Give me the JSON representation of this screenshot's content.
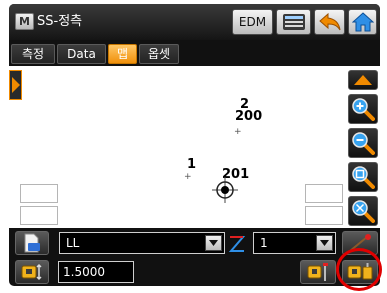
{
  "app": {
    "title": "SS-정측",
    "logo_letter": "M"
  },
  "toolbar": {
    "edm_label": "EDM"
  },
  "tabs": [
    {
      "label": "측정",
      "active": false
    },
    {
      "label": "Data",
      "active": false
    },
    {
      "label": "맵",
      "active": true
    },
    {
      "label": "옵셋",
      "active": false
    }
  ],
  "map": {
    "points": [
      {
        "number": "2",
        "label": "200"
      },
      {
        "number": "1",
        "label": "201"
      }
    ]
  },
  "bottom": {
    "layer_select": "LL",
    "point_select": "1",
    "instrument_height": "1.5000"
  },
  "colors": {
    "accent_orange": "#f0900c",
    "highlight_red": "#e00000"
  },
  "icons": {
    "logo": "app-logo-icon",
    "list": "list-icon",
    "back": "back-arrow-icon",
    "home": "home-icon",
    "pan": "pan-arrow-icon",
    "zoom_in": "zoom-in-icon",
    "zoom_out": "zoom-out-icon",
    "zoom_window": "zoom-window-icon",
    "zoom_all": "zoom-all-icon",
    "stakeout": "stakeout-icon"
  }
}
